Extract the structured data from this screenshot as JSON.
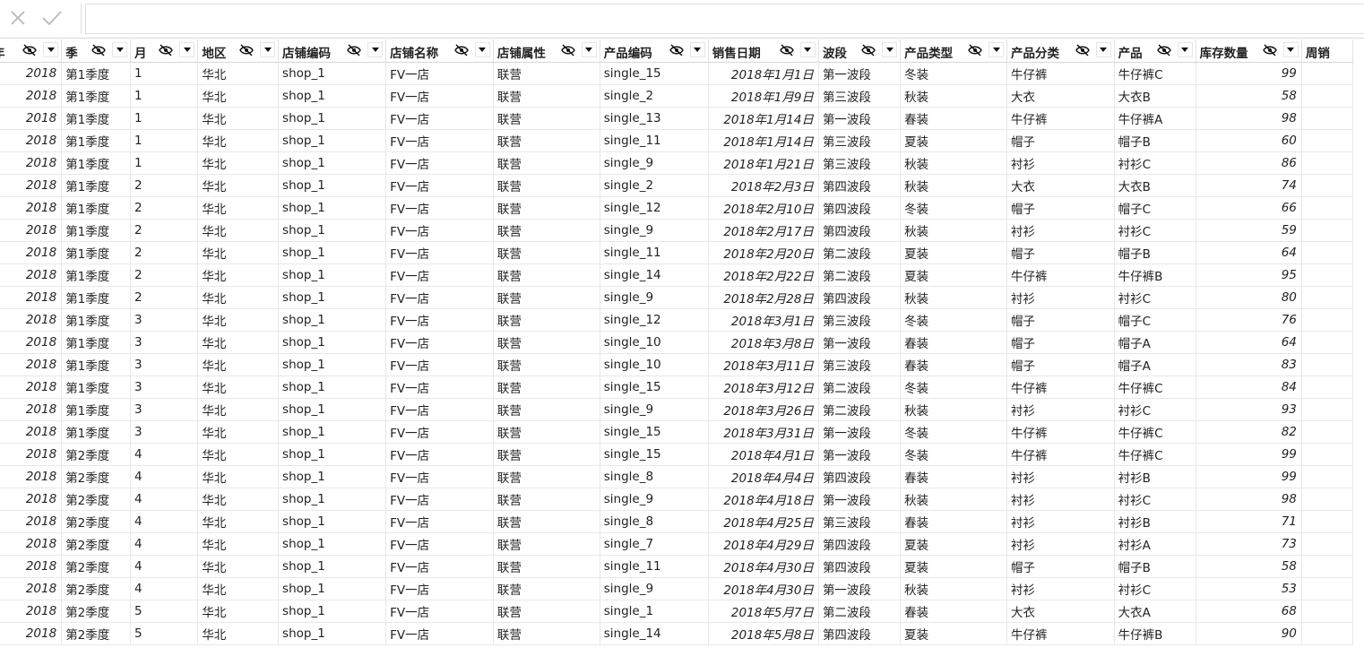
{
  "formula_bar": {
    "value": ""
  },
  "columns": [
    {
      "key": "year",
      "label": "年",
      "align": "num"
    },
    {
      "key": "season",
      "label": "季",
      "align": "txt"
    },
    {
      "key": "month",
      "label": "月",
      "align": "txt"
    },
    {
      "key": "region",
      "label": "地区",
      "align": "txt"
    },
    {
      "key": "shop_code",
      "label": "店铺编码",
      "align": "txt"
    },
    {
      "key": "shop_name",
      "label": "店铺名称",
      "align": "txt"
    },
    {
      "key": "shop_type",
      "label": "店铺属性",
      "align": "txt"
    },
    {
      "key": "product_code",
      "label": "产品编码",
      "align": "txt"
    },
    {
      "key": "sale_date",
      "label": "销售日期",
      "align": "date"
    },
    {
      "key": "wave",
      "label": "波段",
      "align": "txt"
    },
    {
      "key": "product_type",
      "label": "产品类型",
      "align": "txt"
    },
    {
      "key": "product_category",
      "label": "产品分类",
      "align": "txt"
    },
    {
      "key": "product",
      "label": "产品",
      "align": "txt"
    },
    {
      "key": "stock_qty",
      "label": "库存数量",
      "align": "num"
    },
    {
      "key": "week",
      "label": "周销",
      "align": "txt"
    }
  ],
  "rows": [
    [
      "2018",
      "第1季度",
      "1",
      "华北",
      "shop_1",
      "FV一店",
      "联营",
      "single_15",
      "2018年1月1日",
      "第一波段",
      "冬装",
      "牛仔裤",
      "牛仔裤C",
      "99",
      ""
    ],
    [
      "2018",
      "第1季度",
      "1",
      "华北",
      "shop_1",
      "FV一店",
      "联营",
      "single_2",
      "2018年1月9日",
      "第三波段",
      "秋装",
      "大衣",
      "大衣B",
      "58",
      ""
    ],
    [
      "2018",
      "第1季度",
      "1",
      "华北",
      "shop_1",
      "FV一店",
      "联营",
      "single_13",
      "2018年1月14日",
      "第一波段",
      "春装",
      "牛仔裤",
      "牛仔裤A",
      "98",
      ""
    ],
    [
      "2018",
      "第1季度",
      "1",
      "华北",
      "shop_1",
      "FV一店",
      "联营",
      "single_11",
      "2018年1月14日",
      "第三波段",
      "夏装",
      "帽子",
      "帽子B",
      "60",
      ""
    ],
    [
      "2018",
      "第1季度",
      "1",
      "华北",
      "shop_1",
      "FV一店",
      "联营",
      "single_9",
      "2018年1月21日",
      "第三波段",
      "秋装",
      "衬衫",
      "衬衫C",
      "86",
      ""
    ],
    [
      "2018",
      "第1季度",
      "2",
      "华北",
      "shop_1",
      "FV一店",
      "联营",
      "single_2",
      "2018年2月3日",
      "第四波段",
      "秋装",
      "大衣",
      "大衣B",
      "74",
      ""
    ],
    [
      "2018",
      "第1季度",
      "2",
      "华北",
      "shop_1",
      "FV一店",
      "联营",
      "single_12",
      "2018年2月10日",
      "第四波段",
      "冬装",
      "帽子",
      "帽子C",
      "66",
      ""
    ],
    [
      "2018",
      "第1季度",
      "2",
      "华北",
      "shop_1",
      "FV一店",
      "联营",
      "single_9",
      "2018年2月17日",
      "第四波段",
      "秋装",
      "衬衫",
      "衬衫C",
      "59",
      ""
    ],
    [
      "2018",
      "第1季度",
      "2",
      "华北",
      "shop_1",
      "FV一店",
      "联营",
      "single_11",
      "2018年2月20日",
      "第二波段",
      "夏装",
      "帽子",
      "帽子B",
      "64",
      ""
    ],
    [
      "2018",
      "第1季度",
      "2",
      "华北",
      "shop_1",
      "FV一店",
      "联营",
      "single_14",
      "2018年2月22日",
      "第二波段",
      "夏装",
      "牛仔裤",
      "牛仔裤B",
      "95",
      ""
    ],
    [
      "2018",
      "第1季度",
      "2",
      "华北",
      "shop_1",
      "FV一店",
      "联营",
      "single_9",
      "2018年2月28日",
      "第四波段",
      "秋装",
      "衬衫",
      "衬衫C",
      "80",
      ""
    ],
    [
      "2018",
      "第1季度",
      "3",
      "华北",
      "shop_1",
      "FV一店",
      "联营",
      "single_12",
      "2018年3月1日",
      "第三波段",
      "冬装",
      "帽子",
      "帽子C",
      "76",
      ""
    ],
    [
      "2018",
      "第1季度",
      "3",
      "华北",
      "shop_1",
      "FV一店",
      "联营",
      "single_10",
      "2018年3月8日",
      "第一波段",
      "春装",
      "帽子",
      "帽子A",
      "64",
      ""
    ],
    [
      "2018",
      "第1季度",
      "3",
      "华北",
      "shop_1",
      "FV一店",
      "联营",
      "single_10",
      "2018年3月11日",
      "第三波段",
      "春装",
      "帽子",
      "帽子A",
      "83",
      ""
    ],
    [
      "2018",
      "第1季度",
      "3",
      "华北",
      "shop_1",
      "FV一店",
      "联营",
      "single_15",
      "2018年3月12日",
      "第二波段",
      "冬装",
      "牛仔裤",
      "牛仔裤C",
      "84",
      ""
    ],
    [
      "2018",
      "第1季度",
      "3",
      "华北",
      "shop_1",
      "FV一店",
      "联营",
      "single_9",
      "2018年3月26日",
      "第二波段",
      "秋装",
      "衬衫",
      "衬衫C",
      "93",
      ""
    ],
    [
      "2018",
      "第1季度",
      "3",
      "华北",
      "shop_1",
      "FV一店",
      "联营",
      "single_15",
      "2018年3月31日",
      "第一波段",
      "冬装",
      "牛仔裤",
      "牛仔裤C",
      "82",
      ""
    ],
    [
      "2018",
      "第2季度",
      "4",
      "华北",
      "shop_1",
      "FV一店",
      "联营",
      "single_15",
      "2018年4月1日",
      "第一波段",
      "冬装",
      "牛仔裤",
      "牛仔裤C",
      "99",
      ""
    ],
    [
      "2018",
      "第2季度",
      "4",
      "华北",
      "shop_1",
      "FV一店",
      "联营",
      "single_8",
      "2018年4月4日",
      "第四波段",
      "春装",
      "衬衫",
      "衬衫B",
      "99",
      ""
    ],
    [
      "2018",
      "第2季度",
      "4",
      "华北",
      "shop_1",
      "FV一店",
      "联营",
      "single_9",
      "2018年4月18日",
      "第一波段",
      "秋装",
      "衬衫",
      "衬衫C",
      "98",
      ""
    ],
    [
      "2018",
      "第2季度",
      "4",
      "华北",
      "shop_1",
      "FV一店",
      "联营",
      "single_8",
      "2018年4月25日",
      "第三波段",
      "春装",
      "衬衫",
      "衬衫B",
      "71",
      ""
    ],
    [
      "2018",
      "第2季度",
      "4",
      "华北",
      "shop_1",
      "FV一店",
      "联营",
      "single_7",
      "2018年4月29日",
      "第四波段",
      "夏装",
      "衬衫",
      "衬衫A",
      "73",
      ""
    ],
    [
      "2018",
      "第2季度",
      "4",
      "华北",
      "shop_1",
      "FV一店",
      "联营",
      "single_11",
      "2018年4月30日",
      "第四波段",
      "夏装",
      "帽子",
      "帽子B",
      "58",
      ""
    ],
    [
      "2018",
      "第2季度",
      "4",
      "华北",
      "shop_1",
      "FV一店",
      "联营",
      "single_9",
      "2018年4月30日",
      "第一波段",
      "秋装",
      "衬衫",
      "衬衫C",
      "53",
      ""
    ],
    [
      "2018",
      "第2季度",
      "5",
      "华北",
      "shop_1",
      "FV一店",
      "联营",
      "single_1",
      "2018年5月7日",
      "第二波段",
      "春装",
      "大衣",
      "大衣A",
      "68",
      ""
    ],
    [
      "2018",
      "第2季度",
      "5",
      "华北",
      "shop_1",
      "FV一店",
      "联营",
      "single_14",
      "2018年5月8日",
      "第四波段",
      "夏装",
      "牛仔裤",
      "牛仔裤B",
      "90",
      ""
    ]
  ]
}
